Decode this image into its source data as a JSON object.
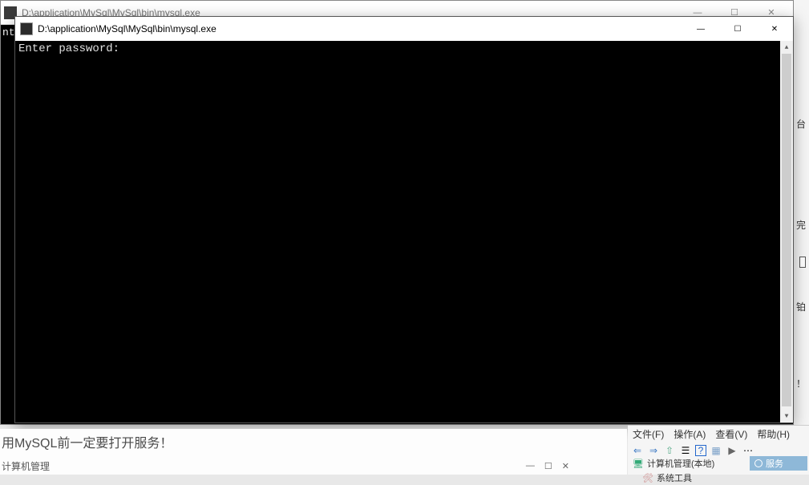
{
  "bg_window": {
    "title": "D:\\application\\MySql\\MySql\\bin\\mysql.exe",
    "body_fragment": "nt"
  },
  "console": {
    "title": "D:\\application\\MySql\\MySql\\bin\\mysql.exe",
    "prompt": "Enter password:"
  },
  "win_controls": {
    "minimize": "—",
    "maximize": "☐",
    "close": "✕"
  },
  "article": {
    "line1": "用MySQL前一定要打开服务！",
    "sub": "计算机管理",
    "mini_min": "—",
    "mini_max": "☐",
    "mini_close": "✕"
  },
  "right_fragments": {
    "f1": "台",
    "f2": "完",
    "f3": "铂",
    "f4": "！"
  },
  "mmc": {
    "menu": {
      "file": "文件(F)",
      "action": "操作(A)",
      "view": "查看(V)",
      "help": "帮助(H)"
    },
    "toolbar_icons": {
      "back": "⇐",
      "forward": "⇒",
      "up": "⇧",
      "props": "☰",
      "help": "?",
      "refresh": "▦",
      "play": "▶",
      "more": "⋯"
    },
    "tree": {
      "root": "计算机管理(本地)",
      "child": "系统工具"
    },
    "services_label": "服务"
  }
}
